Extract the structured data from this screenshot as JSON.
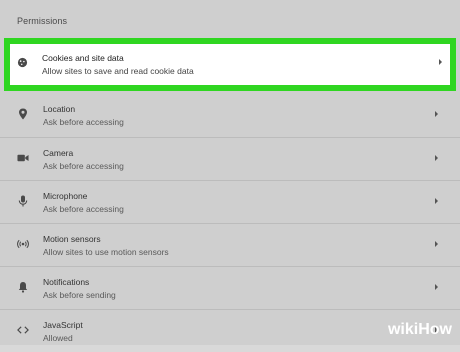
{
  "section": {
    "title": "Permissions"
  },
  "rows": [
    {
      "icon": "cookie-icon",
      "title": "Cookies and site data",
      "subtitle": "Allow sites to save and read cookie data",
      "highlighted": true
    },
    {
      "icon": "location-pin-icon",
      "title": "Location",
      "subtitle": "Ask before accessing"
    },
    {
      "icon": "camera-icon",
      "title": "Camera",
      "subtitle": "Ask before accessing"
    },
    {
      "icon": "microphone-icon",
      "title": "Microphone",
      "subtitle": "Ask before accessing"
    },
    {
      "icon": "motion-sensors-icon",
      "title": "Motion sensors",
      "subtitle": "Allow sites to use motion sensors"
    },
    {
      "icon": "bell-icon",
      "title": "Notifications",
      "subtitle": "Ask before sending"
    },
    {
      "icon": "code-brackets-icon",
      "title": "JavaScript",
      "subtitle": "Allowed"
    }
  ],
  "watermark": {
    "wiki": "wiki",
    "how": "How"
  },
  "colors": {
    "highlight": "#2fd621",
    "background": "#cfcfcf"
  }
}
